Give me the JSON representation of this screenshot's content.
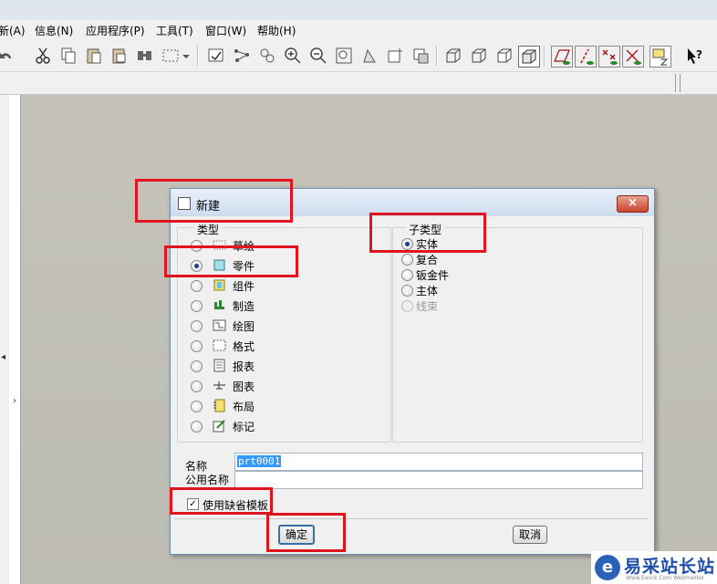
{
  "menu": [
    "新(A)",
    "信息(N)",
    "应用程序(P)",
    "工具(T)",
    "窗口(W)",
    "帮助(H)"
  ],
  "toolbar_icons": [
    "undo-icon",
    "cut-icon",
    "copy-icon",
    "paste-icon",
    "paste-special-icon",
    "find-icon",
    "select-box-icon",
    "regenerate-icon",
    "datum-icon",
    "connect-icon",
    "zoom-in-icon",
    "zoom-out-icon",
    "refit-icon",
    "orient-icon",
    "view-manager-icon",
    "layers-icon",
    "shade-wire-icon",
    "hidden-line-icon",
    "no-hidden-icon",
    "shaded-icon",
    "plane-display-icon",
    "axis-display-icon",
    "point-display-icon",
    "csys-display-icon",
    "annotation-display-icon",
    "context-help-icon"
  ],
  "dialog": {
    "title": "新建",
    "close_label": "×",
    "type_legend": "类型",
    "types": [
      {
        "label": "草绘",
        "icon": "sketch-icon",
        "selected": false
      },
      {
        "label": "零件",
        "icon": "part-icon",
        "selected": true
      },
      {
        "label": "组件",
        "icon": "assembly-icon",
        "selected": false
      },
      {
        "label": "制造",
        "icon": "manufacturing-icon",
        "selected": false
      },
      {
        "label": "绘图",
        "icon": "drawing-icon",
        "selected": false
      },
      {
        "label": "格式",
        "icon": "format-icon",
        "selected": false
      },
      {
        "label": "报表",
        "icon": "report-icon",
        "selected": false
      },
      {
        "label": "图表",
        "icon": "diagram-icon",
        "selected": false
      },
      {
        "label": "布局",
        "icon": "layout-icon",
        "selected": false
      },
      {
        "label": "标记",
        "icon": "markup-icon",
        "selected": false
      }
    ],
    "subtype_legend": "子类型",
    "subtypes": [
      {
        "label": "实体",
        "selected": true,
        "disabled": false
      },
      {
        "label": "复合",
        "selected": false,
        "disabled": false
      },
      {
        "label": "钣金件",
        "selected": false,
        "disabled": false
      },
      {
        "label": "主体",
        "selected": false,
        "disabled": false
      },
      {
        "label": "线束",
        "selected": false,
        "disabled": true
      }
    ],
    "name_label": "名称",
    "name_value": "prt0001",
    "common_name_label": "公用名称",
    "common_name_value": "",
    "use_default_template_label": "使用缺省模板",
    "use_default_template_checked": true,
    "ok_label": "确定",
    "cancel_label": "取消"
  },
  "watermark": {
    "text": "易采站长站",
    "sub": "Www.Easck.Com  Webmaster"
  },
  "colors": {
    "annotation_red": "#e0141e",
    "selection_blue": "#3399ff",
    "canvas": "#c5c3b9"
  }
}
